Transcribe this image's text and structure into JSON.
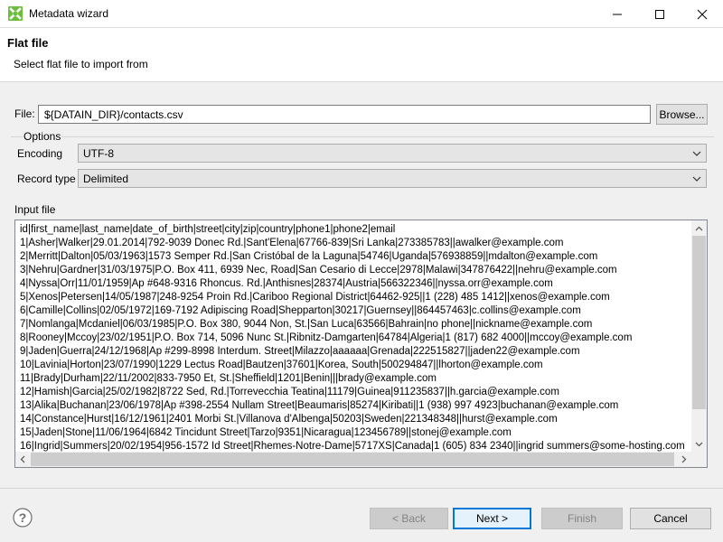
{
  "window": {
    "title": "Metadata wizard",
    "app_icon": "green-x-icon",
    "controls": [
      "minimize-icon",
      "maximize-icon",
      "close-icon"
    ]
  },
  "header": {
    "title": "Flat file",
    "description": "Select flat file to import from"
  },
  "file": {
    "label": "File:",
    "value": "${DATAIN_DIR}/contacts.csv",
    "browse_label": "Browse..."
  },
  "options": {
    "group_label": "Options",
    "encoding_label": "Encoding",
    "encoding_value": "UTF-8",
    "record_type_label": "Record type",
    "record_type_value": "Delimited"
  },
  "input_file": {
    "label": "Input file",
    "lines": [
      "id|first_name|last_name|date_of_birth|street|city|zip|country|phone1|phone2|email",
      "1|Asher|Walker|29.01.2014|792-9039 Donec Rd.|Sant'Elena|67766-839|Sri Lanka|273385783||awalker@example.com",
      "2|Merritt|Dalton|05/03/1963|1573 Semper Rd.|San Cristóbal de la Laguna|54746|Uganda|576938859||mdalton@example.com",
      "3|Nehru|Gardner|31/03/1975|P.O. Box 411, 6939 Nec, Road|San Cesario di Lecce|2978|Malawi|347876422||nehru@example.com",
      "4|Nyssa|Orr|11/01/1959|Ap #648-9316 Rhoncus. Rd.|Anthisnes|28374|Austria|566322346||nyssa.orr@example.com",
      "5|Xenos|Petersen|14/05/1987|248-9254 Proin Rd.|Cariboo Regional District|64462-925||1 (228) 485 1412||xenos@example.com",
      "6|Camille|Collins|02/05/1972|169-7192 Adipiscing Road|Shepparton|30217|Guernsey||864457463|c.collins@example.com",
      "7|Nomlanga|Mcdaniel|06/03/1985|P.O. Box 380, 9044 Non, St.|San Luca|63566|Bahrain|no phone||nickname@example.com",
      "8|Rooney|Mccoy|23/02/1951|P.O. Box 714, 5096 Nunc St.|Ribnitz-Damgarten|64784|Algeria|1 (817) 682 4000||mccoy@example.com",
      "9|Jaden|Guerra|24/12/1968|Ap #299-8998 Interdum. Street|Milazzo|aaaaaa|Grenada|222515827||jaden22@example.com",
      "10|Lavinia|Horton|23/07/1990|1229 Lectus Road|Bautzen|37601|Korea, South|500294847||lhorton@example.com",
      "11|Brady|Durham|22/11/2002|833-7950 Et, St.|Sheffield|1201|Benin|||brady@example.com",
      "12|Hamish|Garcia|25/02/1982|8722 Sed, Rd.|Torrevecchia Teatina|11179|Guinea|911235837||h.garcia@example.com",
      "13|Alika|Buchanan|23/06/1978|Ap #398-2554 Nullam Street|Beaumaris|85274|Kiribati||1 (938) 997 4923|buchanan@example.com",
      "14|Constance|Hurst|16/12/1961|2401 Morbi St.|Villanova d'Albenga|50203|Sweden|221348348||hurst@example.com",
      "15|Jaden|Stone|11/06/1964|6842 Tincidunt Street|Tarzo|9351|Nicaragua|123456789||stonej@example.com",
      "16|Ingrid|Summers|20/02/1954|956-1572 Id Street|Rhemes-Notre-Dame|5717XS|Canada|1 (605) 834 2340||ingrid summers@some-hosting.com"
    ]
  },
  "buttons": {
    "help_icon": "help-icon",
    "back": "< Back",
    "next": "Next >",
    "finish": "Finish",
    "cancel": "Cancel"
  },
  "colors": {
    "accent": "#0078d7",
    "app_icon_green": "#6bbf3c"
  }
}
